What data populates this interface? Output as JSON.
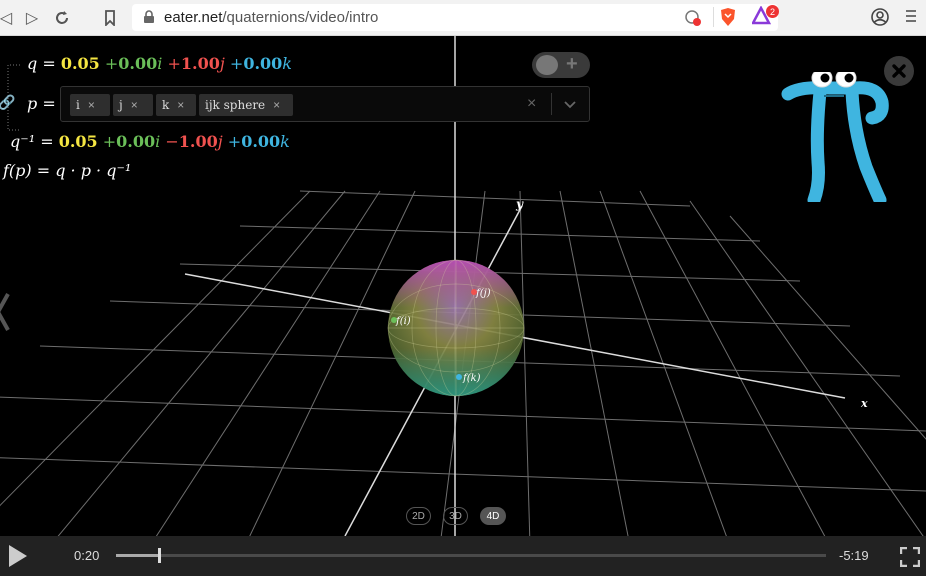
{
  "browser": {
    "url_host": "eater.net",
    "url_path": "/quaternions/video/intro",
    "shields_badge": "2",
    "icons": [
      "back-icon",
      "forward-icon",
      "reload-icon",
      "bookmark-icon",
      "lock-icon",
      "brave-shield-icon",
      "brave-rewards-icon",
      "profile-icon",
      "menu-icon"
    ]
  },
  "equations": {
    "q": {
      "lhs": "q =",
      "w": "0.05",
      "i": "0.00",
      "j": "1.00",
      "k": "0.00",
      "op_i": "+",
      "op_j": "+",
      "op_k": "+"
    },
    "p_label": "p =",
    "p_chips": [
      {
        "label": "i",
        "remove": "×"
      },
      {
        "label": "j",
        "remove": "×"
      },
      {
        "label": "k",
        "remove": "×"
      },
      {
        "label": "ijk sphere",
        "remove": "×"
      }
    ],
    "p_clear": "×",
    "qinv": {
      "lhs": "q⁻¹ =",
      "w": "0.05",
      "i": "0.00",
      "j": "1.00",
      "k": "0.00",
      "op_i": "+",
      "op_j": "−",
      "op_k": "+"
    },
    "fp": "f(p) = q · p · q⁻¹"
  },
  "scene": {
    "axis_y": "y",
    "axis_x": "x",
    "point_labels": [
      "f(i)",
      "f(j)",
      "f(k)"
    ],
    "dim_buttons": [
      "2D",
      "3D",
      "4D"
    ],
    "active_dim": "4D"
  },
  "video": {
    "elapsed": "0:20",
    "remaining": "-5:19",
    "progress": 0.06
  },
  "colors": {
    "w": "#f5e642",
    "i": "#6bbf59",
    "j": "#f0524f",
    "k": "#3fb5e0",
    "mascot": "#3fb5e0"
  }
}
